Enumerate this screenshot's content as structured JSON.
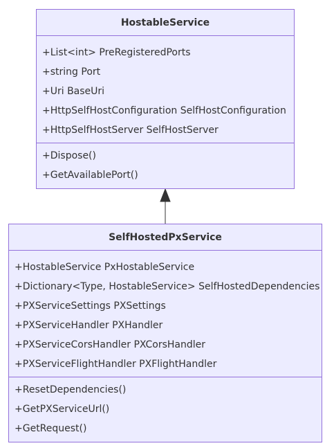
{
  "classes": {
    "hostable_service": {
      "name": "HostableService",
      "attributes": [
        "+List<int> PreRegisteredPorts",
        "+string Port",
        "+Uri BaseUri",
        "+HttpSelfHostConfiguration SelfHostConfiguration",
        "+HttpSelfHostServer SelfHostServer"
      ],
      "methods": [
        "+Dispose()",
        "+GetAvailablePort()"
      ]
    },
    "self_hosted_px_service": {
      "name": "SelfHostedPxService",
      "attributes": [
        "+HostableService PxHostableService",
        "+Dictionary<Type, HostableService> SelfHostedDependencies",
        "+PXServiceSettings PXSettings",
        "+PXServiceHandler PXHandler",
        "+PXServiceCorsHandler PXCorsHandler",
        "+PXServiceFlightHandler PXFlightHandler"
      ],
      "methods": [
        "+ResetDependencies()",
        "+GetPXServiceUrl()",
        "+GetRequest()"
      ]
    }
  },
  "relations": [
    {
      "from": "SelfHostedPxService",
      "to": "HostableService",
      "type": "inheritance"
    }
  ],
  "colors": {
    "box_fill": "#ECECFF",
    "box_border": "#9370DB",
    "text": "#333333",
    "edge": "#333333"
  }
}
